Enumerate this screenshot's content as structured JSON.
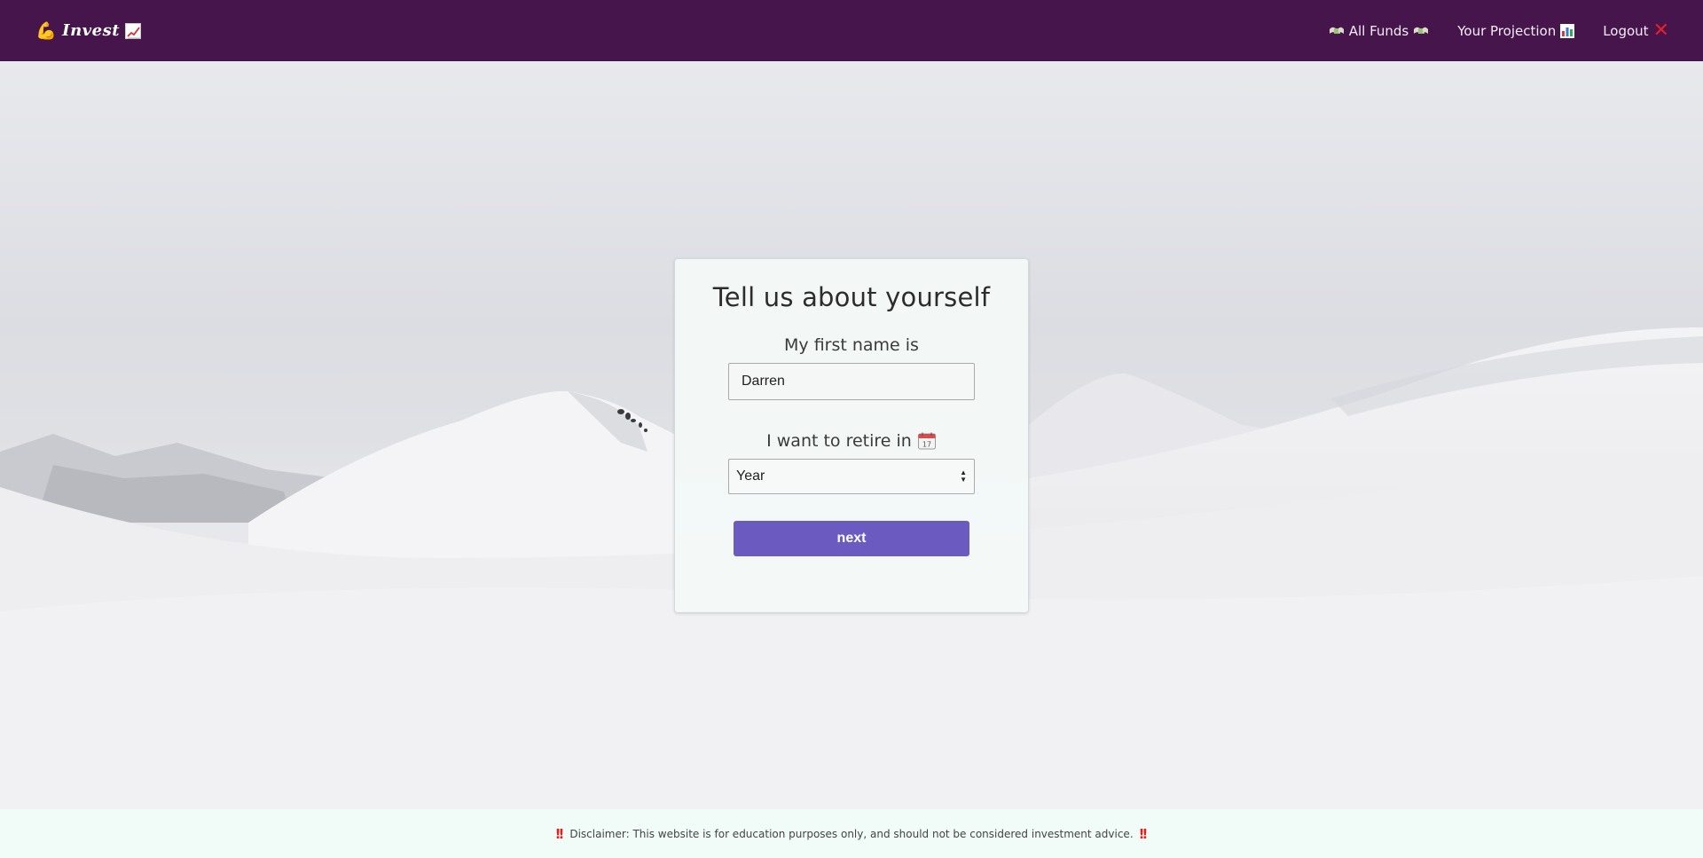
{
  "navbar": {
    "brand_text": "Invest",
    "brand_icon_left": "flexed-biceps-icon",
    "brand_icon_right": "chart-increasing-icon",
    "links": [
      {
        "label": "All Funds",
        "icon": "money-with-wings-icon"
      },
      {
        "label": "Your Projection",
        "icon": "bar-chart-icon"
      },
      {
        "label": "Logout",
        "icon": "cross-mark-icon"
      }
    ],
    "background_color": "#45154c"
  },
  "form": {
    "title": "Tell us about yourself",
    "name_label": "My first name is",
    "name_value": "Darren",
    "retire_label": "I want to retire in",
    "retire_icon": "calendar-icon",
    "retire_select_value": "Year",
    "submit_label": "next",
    "accent_color": "#6b5ac0"
  },
  "footer": {
    "disclaimer": "Disclaimer: This website is for education purposes only, and should not be considered investment advice.",
    "icon": "double-exclamation-icon"
  }
}
